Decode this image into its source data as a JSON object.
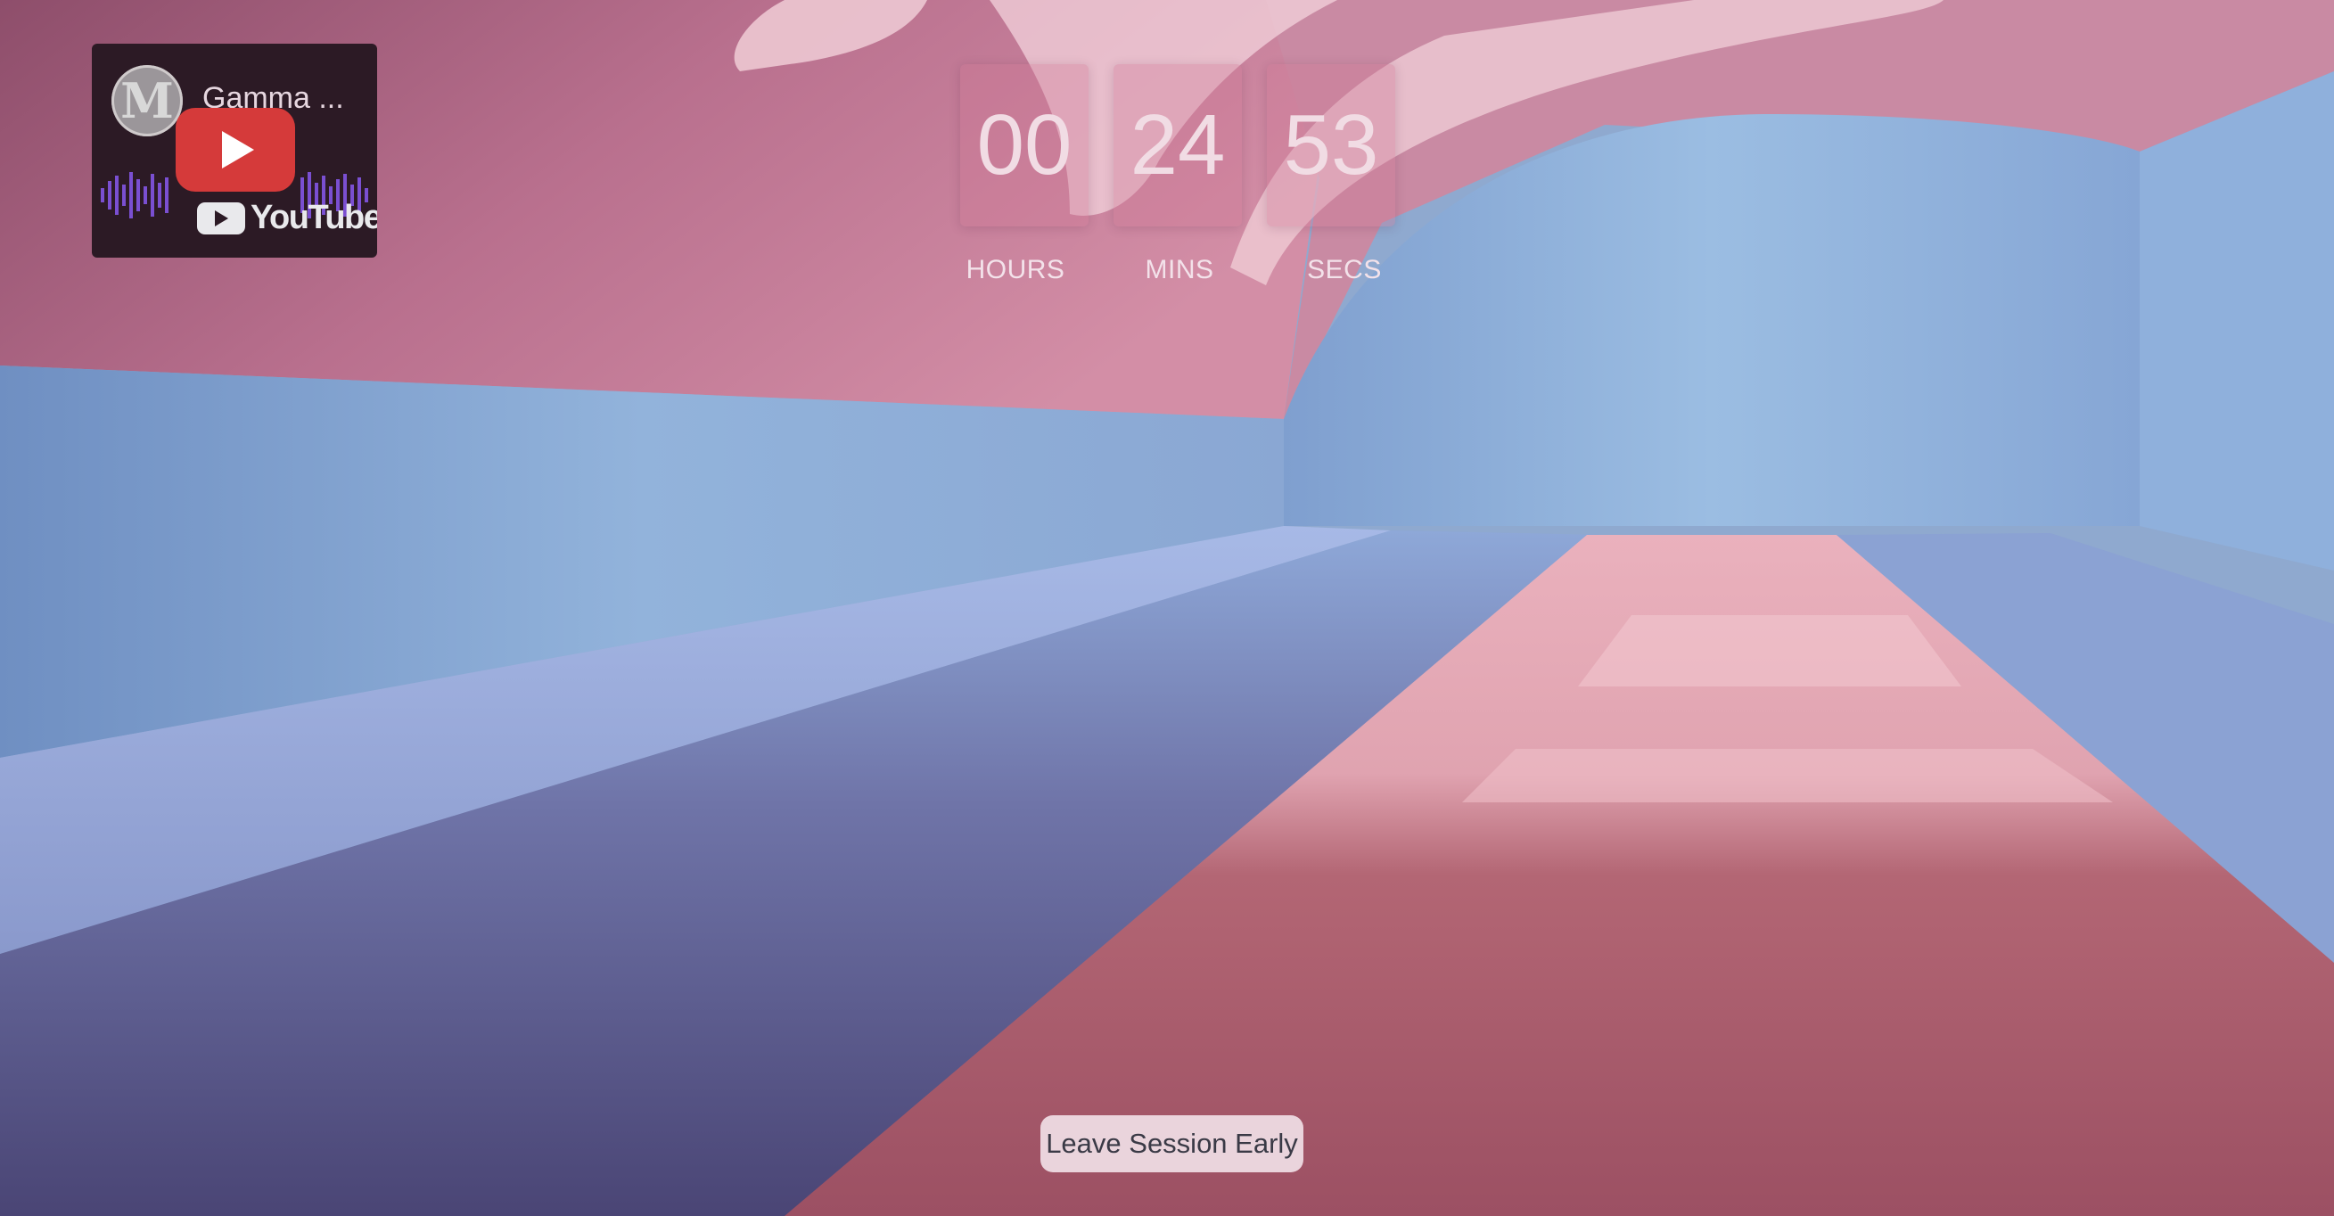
{
  "youtube_card": {
    "channel_title": "Gamma ...",
    "avatar_letter": "M",
    "brand_name": "YouTube",
    "play_icon": "play-icon",
    "brand_icon": "youtube-logo-icon"
  },
  "countdown": {
    "hours": "00",
    "mins": "24",
    "secs": "53",
    "hours_label": "HOURS",
    "mins_label": "MINS",
    "secs_label": "SECS"
  },
  "actions": {
    "leave_label": "Leave Session Early"
  },
  "colors": {
    "wall_pink": "#a9607f",
    "wall_blue": "#8fb1d9",
    "walkway": "#b46a78",
    "water": "#5b5f8f",
    "play_red": "#d53a3a"
  }
}
